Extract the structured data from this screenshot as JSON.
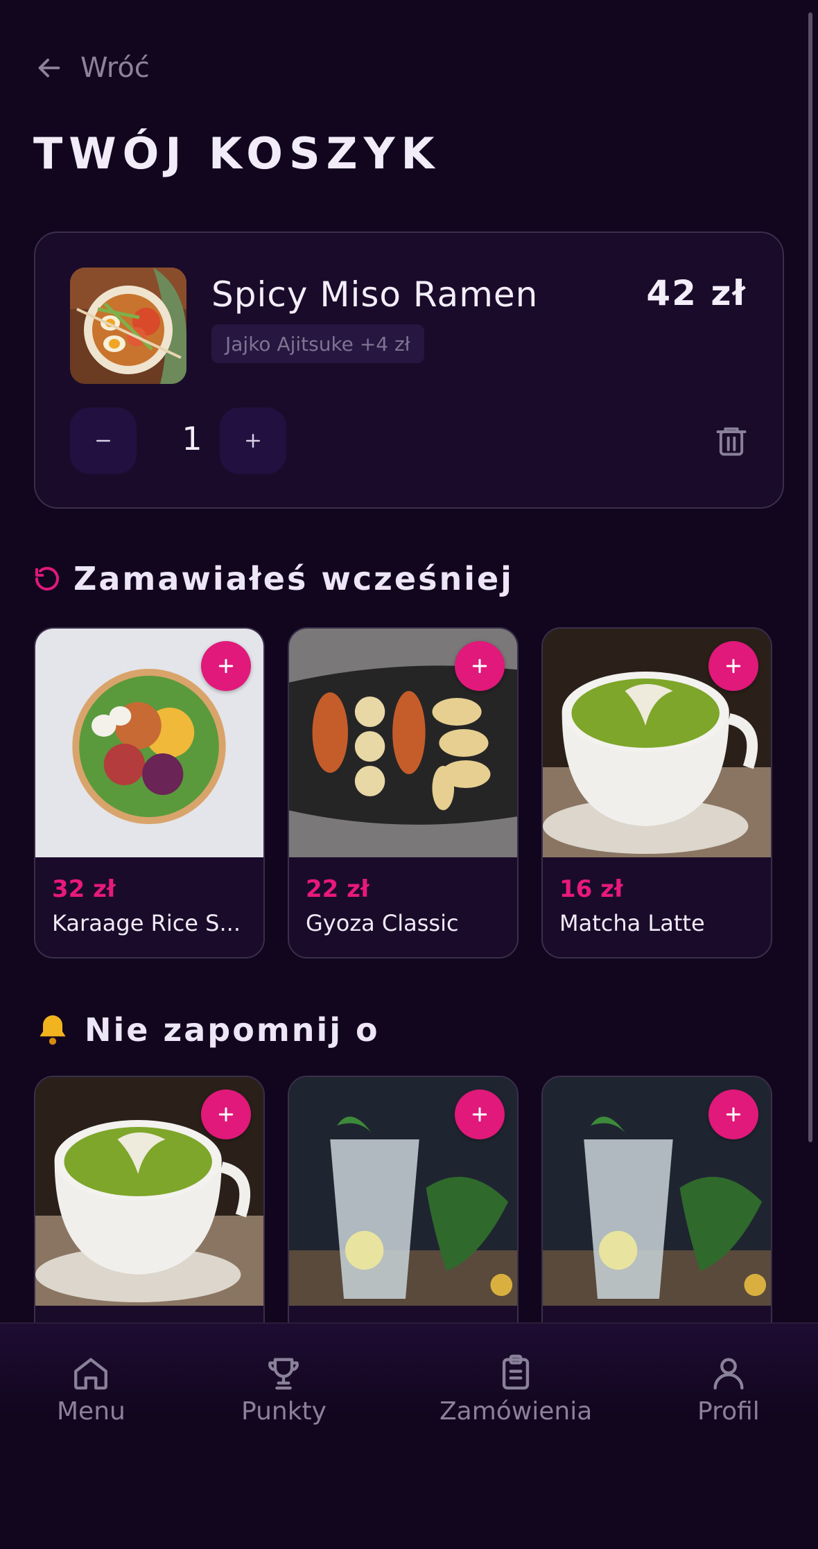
{
  "back": {
    "label": "Wróć"
  },
  "page_title": "TWÓJ KOSZYK",
  "cart_item": {
    "name": "Spicy Miso Ramen",
    "price": "42 zł",
    "addon": "Jajko Ajitsuke +4 zł",
    "quantity": "1",
    "decrement_icon": "minus-icon",
    "increment_icon": "plus-icon",
    "delete_icon": "trash-icon"
  },
  "sections": {
    "previous": {
      "title": "Zamawiałeś wcześniej",
      "icon": "history-icon",
      "items": [
        {
          "price": "32 zł",
          "name": "Karaage Rice S..."
        },
        {
          "price": "22 zł",
          "name": "Gyoza Classic"
        },
        {
          "price": "16 zł",
          "name": "Matcha Latte"
        }
      ]
    },
    "reminder": {
      "title": "Nie zapomnij o",
      "icon": "bell-icon",
      "items": [
        {
          "name": "matcha-latte"
        },
        {
          "name": "mojito-drink"
        },
        {
          "name": "mojito-drink"
        }
      ]
    }
  },
  "nav": [
    {
      "label": "Menu",
      "icon": "home-icon"
    },
    {
      "label": "Punkty",
      "icon": "trophy-icon"
    },
    {
      "label": "Zamówienia",
      "icon": "clipboard-icon"
    },
    {
      "label": "Profil",
      "icon": "user-icon"
    }
  ],
  "colors": {
    "background": "#12061f",
    "accent": "#e0197a",
    "card": "#1a0b2a",
    "muted": "#8a819a"
  }
}
